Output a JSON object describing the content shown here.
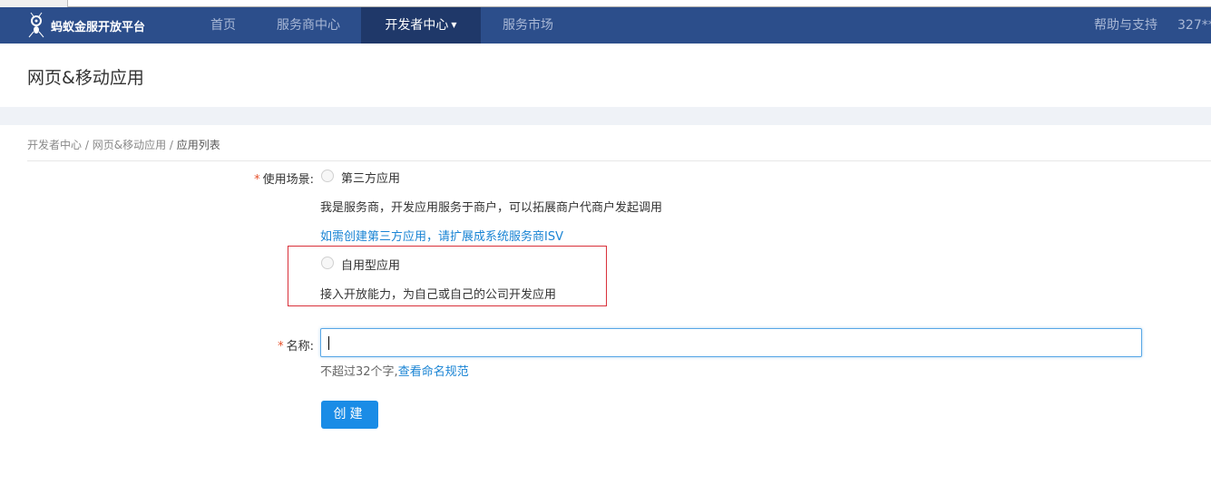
{
  "nav": {
    "logo": "蚂蚁金服开放平台",
    "items": [
      {
        "label": "首页"
      },
      {
        "label": "服务商中心"
      },
      {
        "label": "开发者中心",
        "active": true
      },
      {
        "label": "服务市场"
      }
    ],
    "help": "帮助与支持",
    "user": "327**"
  },
  "page_title": "网页&移动应用",
  "breadcrumb": {
    "items": [
      "开发者中心",
      "网页&移动应用",
      "应用列表"
    ],
    "sep": "/"
  },
  "form": {
    "scene_label": "使用场景:",
    "options": [
      {
        "label": "第三方应用",
        "desc": "我是服务商，开发应用服务于商户，可以拓展商户代商户发起调用",
        "link": "如需创建第三方应用，请扩展成系统服务商ISV"
      },
      {
        "label": "自用型应用",
        "desc": "接入开放能力，为自己或自己的公司开发应用"
      }
    ],
    "name_label": "名称:",
    "name_value": "",
    "name_hint": "不超过32个字,",
    "name_hint_link": "查看命名规范",
    "required_mark": "*",
    "submit": "创建"
  },
  "colors": {
    "nav_bg": "#2c4e8b",
    "nav_active": "#1f3869",
    "link": "#1a84d4",
    "button": "#1a8ce6",
    "highlight": "#d9313a"
  }
}
